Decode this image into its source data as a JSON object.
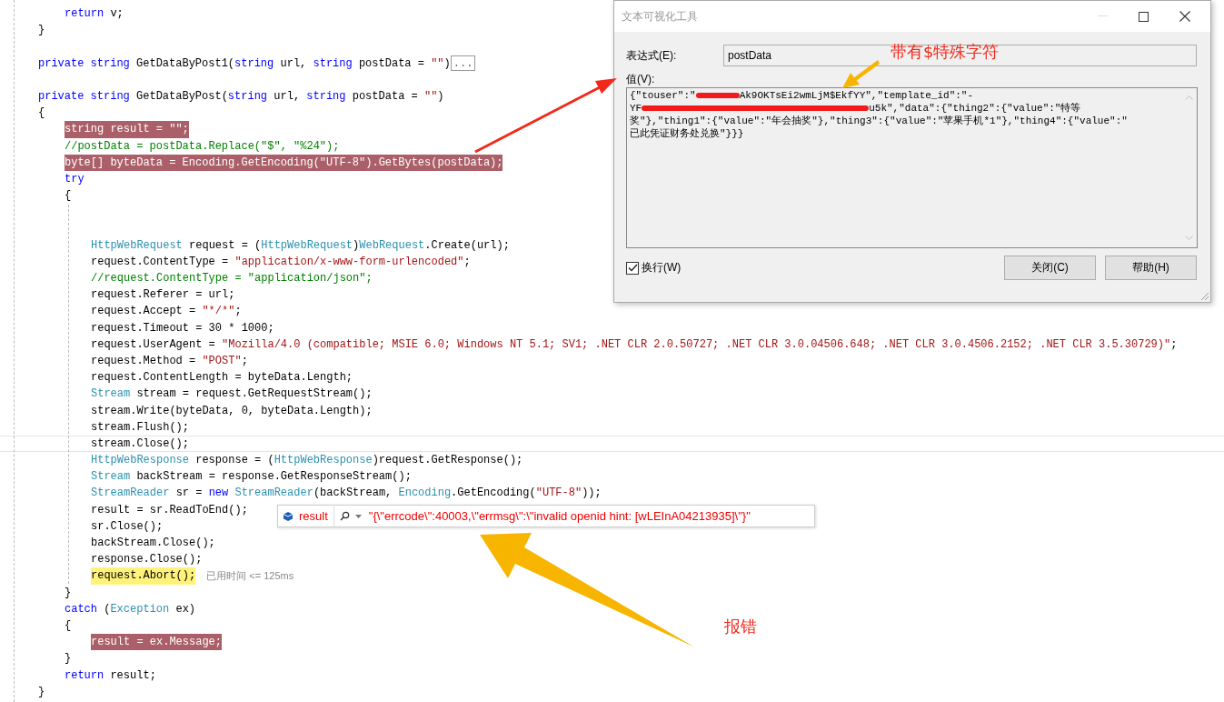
{
  "code": {
    "lines": [
      {
        "kind": "offscreen",
        "children": [
          {
            "kind": "code",
            "breakpoint": false,
            "current": false,
            "caret": false,
            "tokens": [
              {
                "kind": "kw",
                "text": "return "
              },
              {
                "kind": "plain",
                "text": "v;"
              }
            ]
          }
        ]
      },
      {
        "kind": "code",
        "breakpoint": false,
        "current": false,
        "caret": false,
        "tokens": [
          {
            "kind": "plain",
            "text": "}"
          }
        ]
      },
      {
        "kind": "blank"
      },
      {
        "kind": "code",
        "breakpoint": false,
        "current": false,
        "caret": false,
        "tokens": [
          {
            "kind": "kw",
            "text": "private "
          },
          {
            "kind": "kw",
            "text": "string "
          },
          {
            "kind": "plain",
            "text": "GetDataByPost1("
          },
          {
            "kind": "kw",
            "text": "string "
          },
          {
            "kind": "plain",
            "text": "url, "
          },
          {
            "kind": "kw",
            "text": "string "
          },
          {
            "kind": "plain",
            "text": "postData = "
          },
          {
            "kind": "str",
            "text": "\"\""
          },
          {
            "kind": "plain",
            "text": ")"
          }
        ],
        "collapsed": "..."
      },
      {
        "kind": "blank"
      },
      {
        "kind": "code",
        "breakpoint": false,
        "current": false,
        "caret": false,
        "tokens": [
          {
            "kind": "kw",
            "text": "private "
          },
          {
            "kind": "kw",
            "text": "string "
          },
          {
            "kind": "plain",
            "text": "GetDataByPost("
          },
          {
            "kind": "kw",
            "text": "string "
          },
          {
            "kind": "plain",
            "text": "url, "
          },
          {
            "kind": "kw",
            "text": "string "
          },
          {
            "kind": "plain",
            "text": "postData = "
          },
          {
            "kind": "str",
            "text": "\"\""
          },
          {
            "kind": "plain",
            "text": ")"
          }
        ]
      },
      {
        "kind": "code",
        "breakpoint": false,
        "current": false,
        "caret": false,
        "tokens": [
          {
            "kind": "plain",
            "text": "{"
          }
        ],
        "children": [
          {
            "kind": "code",
            "breakpoint": true,
            "current": false,
            "caret": false,
            "text": "string result = \"\";"
          },
          {
            "kind": "code",
            "breakpoint": false,
            "current": false,
            "caret": false,
            "tokens": [
              {
                "kind": "comment",
                "text": "//postData = postData.Replace(\"$\", \"%24\");"
              }
            ]
          },
          {
            "kind": "code",
            "breakpoint": true,
            "current": false,
            "caret": false,
            "text": "byte[] byteData = Encoding.GetEncoding(\"UTF-8\").GetBytes(postData);"
          },
          {
            "kind": "code",
            "breakpoint": false,
            "current": false,
            "caret": false,
            "tokens": [
              {
                "kind": "kw",
                "text": "try"
              }
            ]
          },
          {
            "kind": "code",
            "breakpoint": false,
            "current": false,
            "caret": false,
            "tokens": [
              {
                "kind": "plain",
                "text": "{"
              }
            ],
            "children": [
              {
                "kind": "blank"
              },
              {
                "kind": "blank"
              },
              {
                "kind": "code",
                "breakpoint": false,
                "current": false,
                "caret": false,
                "tokens": [
                  {
                    "kind": "type",
                    "text": "HttpWebRequest "
                  },
                  {
                    "kind": "plain",
                    "text": "request = ("
                  },
                  {
                    "kind": "type",
                    "text": "HttpWebRequest"
                  },
                  {
                    "kind": "plain",
                    "text": ")"
                  },
                  {
                    "kind": "type",
                    "text": "WebRequest"
                  },
                  {
                    "kind": "plain",
                    "text": ".Create(url);"
                  }
                ]
              },
              {
                "kind": "code",
                "breakpoint": false,
                "current": false,
                "caret": false,
                "tokens": [
                  {
                    "kind": "plain",
                    "text": "request.ContentType = "
                  },
                  {
                    "kind": "str",
                    "text": "\"application/x-www-form-urlencoded\""
                  },
                  {
                    "kind": "plain",
                    "text": ";"
                  }
                ]
              },
              {
                "kind": "code",
                "breakpoint": false,
                "current": false,
                "caret": false,
                "tokens": [
                  {
                    "kind": "comment",
                    "text": "//request.ContentType = \"application/json\";"
                  }
                ]
              },
              {
                "kind": "code",
                "breakpoint": false,
                "current": false,
                "caret": false,
                "tokens": [
                  {
                    "kind": "plain",
                    "text": "request.Referer = url;"
                  }
                ]
              },
              {
                "kind": "code",
                "breakpoint": false,
                "current": false,
                "caret": false,
                "tokens": [
                  {
                    "kind": "plain",
                    "text": "request.Accept = "
                  },
                  {
                    "kind": "str",
                    "text": "\"*/*\""
                  },
                  {
                    "kind": "plain",
                    "text": ";"
                  }
                ]
              },
              {
                "kind": "code",
                "breakpoint": false,
                "current": false,
                "caret": false,
                "tokens": [
                  {
                    "kind": "plain",
                    "text": "request.Timeout = 30 * 1000;"
                  }
                ]
              },
              {
                "kind": "code",
                "breakpoint": false,
                "current": false,
                "caret": false,
                "tokens": [
                  {
                    "kind": "plain",
                    "text": "request.UserAgent = "
                  },
                  {
                    "kind": "str",
                    "text": "\"Mozilla/4.0 (compatible; MSIE 6.0; Windows NT 5.1; SV1; .NET CLR 2.0.50727; .NET CLR 3.0.04506.648; .NET CLR 3.0.4506.2152; .NET CLR 3.5.30729)\""
                  },
                  {
                    "kind": "plain",
                    "text": ";"
                  }
                ]
              },
              {
                "kind": "code",
                "breakpoint": false,
                "current": false,
                "caret": false,
                "tokens": [
                  {
                    "kind": "plain",
                    "text": "request.Method = "
                  },
                  {
                    "kind": "str",
                    "text": "\"POST\""
                  },
                  {
                    "kind": "plain",
                    "text": ";"
                  }
                ]
              },
              {
                "kind": "code",
                "breakpoint": false,
                "current": false,
                "caret": false,
                "tokens": [
                  {
                    "kind": "plain",
                    "text": "request.ContentLength = byteData.Length;"
                  }
                ]
              },
              {
                "kind": "code",
                "breakpoint": false,
                "current": false,
                "caret": false,
                "tokens": [
                  {
                    "kind": "type",
                    "text": "Stream "
                  },
                  {
                    "kind": "plain",
                    "text": "stream = request.GetRequestStream();"
                  }
                ]
              },
              {
                "kind": "code",
                "breakpoint": false,
                "current": false,
                "caret": false,
                "tokens": [
                  {
                    "kind": "plain",
                    "text": "stream.Write(byteData, 0, byteData.Length);"
                  }
                ]
              },
              {
                "kind": "code",
                "breakpoint": false,
                "current": false,
                "caret": false,
                "tokens": [
                  {
                    "kind": "plain",
                    "text": "stream.Flush();"
                  }
                ]
              },
              {
                "kind": "code",
                "breakpoint": false,
                "current": false,
                "caret": true,
                "tokens": [
                  {
                    "kind": "plain",
                    "text": "stream.Close();"
                  }
                ]
              },
              {
                "kind": "code",
                "breakpoint": false,
                "current": false,
                "caret": false,
                "tokens": [
                  {
                    "kind": "type",
                    "text": "HttpWebResponse "
                  },
                  {
                    "kind": "plain",
                    "text": "response = ("
                  },
                  {
                    "kind": "type",
                    "text": "HttpWebResponse"
                  },
                  {
                    "kind": "plain",
                    "text": ")request.GetResponse();"
                  }
                ]
              },
              {
                "kind": "code",
                "breakpoint": false,
                "current": false,
                "caret": false,
                "tokens": [
                  {
                    "kind": "type",
                    "text": "Stream "
                  },
                  {
                    "kind": "plain",
                    "text": "backStream = response.GetResponseStream();"
                  }
                ]
              },
              {
                "kind": "code",
                "breakpoint": false,
                "current": false,
                "caret": false,
                "tokens": [
                  {
                    "kind": "type",
                    "text": "StreamReader "
                  },
                  {
                    "kind": "plain",
                    "text": "sr = "
                  },
                  {
                    "kind": "kw",
                    "text": "new "
                  },
                  {
                    "kind": "type",
                    "text": "StreamReader"
                  },
                  {
                    "kind": "plain",
                    "text": "(backStream, "
                  },
                  {
                    "kind": "type",
                    "text": "Encoding"
                  },
                  {
                    "kind": "plain",
                    "text": ".GetEncoding("
                  },
                  {
                    "kind": "str",
                    "text": "\"UTF-8\""
                  },
                  {
                    "kind": "plain",
                    "text": "));"
                  }
                ]
              },
              {
                "kind": "code",
                "breakpoint": false,
                "current": false,
                "caret": false,
                "tokens": [
                  {
                    "kind": "plain",
                    "text": "result = sr.ReadToEnd();"
                  }
                ]
              },
              {
                "kind": "code",
                "breakpoint": false,
                "current": false,
                "caret": false,
                "tokens": [
                  {
                    "kind": "plain",
                    "text": "sr.Close();"
                  }
                ]
              },
              {
                "kind": "code",
                "breakpoint": false,
                "current": false,
                "caret": false,
                "tokens": [
                  {
                    "kind": "plain",
                    "text": "backStream.Close();"
                  }
                ]
              },
              {
                "kind": "code",
                "breakpoint": false,
                "current": false,
                "caret": false,
                "tokens": [
                  {
                    "kind": "plain",
                    "text": "response.Close();"
                  }
                ]
              },
              {
                "kind": "code",
                "breakpoint": false,
                "current": true,
                "caret": false,
                "tokens": [
                  {
                    "kind": "plain",
                    "text": "request.Abort();"
                  }
                ],
                "hint": "已用时间 <= 125ms"
              }
            ]
          },
          {
            "kind": "code",
            "breakpoint": false,
            "current": false,
            "caret": false,
            "tokens": [
              {
                "kind": "plain",
                "text": "}"
              }
            ]
          },
          {
            "kind": "code",
            "breakpoint": false,
            "current": false,
            "caret": false,
            "tokens": [
              {
                "kind": "kw",
                "text": "catch "
              },
              {
                "kind": "plain",
                "text": "("
              },
              {
                "kind": "type",
                "text": "Exception "
              },
              {
                "kind": "plain",
                "text": "ex)"
              }
            ]
          },
          {
            "kind": "code",
            "breakpoint": false,
            "current": false,
            "caret": false,
            "tokens": [
              {
                "kind": "plain",
                "text": "{"
              }
            ],
            "children": [
              {
                "kind": "code",
                "breakpoint": true,
                "current": false,
                "caret": false,
                "text": "result = ex.Message;"
              }
            ]
          },
          {
            "kind": "code",
            "breakpoint": false,
            "current": false,
            "caret": false,
            "tokens": [
              {
                "kind": "plain",
                "text": "}"
              }
            ]
          },
          {
            "kind": "code",
            "breakpoint": false,
            "current": false,
            "caret": false,
            "tokens": [
              {
                "kind": "kw",
                "text": "return "
              },
              {
                "kind": "plain",
                "text": "result;"
              }
            ]
          }
        ]
      },
      {
        "kind": "code",
        "breakpoint": false,
        "current": false,
        "caret": false,
        "tokens": [
          {
            "kind": "plain",
            "text": "}"
          }
        ]
      }
    ]
  },
  "datatip": {
    "name": "result",
    "value": "\"{\\\"errcode\\\":40003,\\\"errmsg\\\":\\\"invalid openid hint: [wLEInA04213935]\\\"}\""
  },
  "dialog": {
    "title": "文本可视化工具",
    "expression_label": "表达式(E):",
    "expression_value": "postData",
    "value_label": "值(V):",
    "value_lines": [
      [
        {
          "kind": "text",
          "text": "{\"touser\":\""
        },
        {
          "kind": "redacted"
        },
        {
          "kind": "text",
          "text": "Ak9OKTsEi2wmLjM$EkfYY\",\"template_id\":\"-"
        }
      ],
      [
        {
          "kind": "text",
          "text": "YF"
        },
        {
          "kind": "redacted"
        },
        {
          "kind": "text",
          "text": "u5k\",\"data\":{\"thing2\":{\"value\":\"特等"
        }
      ],
      [
        {
          "kind": "text",
          "text": "奖\"},\"thing1\":{\"value\":\"年会抽奖\"},\"thing3\":{\"value\":\"苹果手机*1\"},\"thing4\":{\"value\":\""
        }
      ],
      [
        {
          "kind": "text",
          "text": "已此凭证财务处兑换\"}}}"
        }
      ]
    ],
    "wrap": {
      "label": "换行(W)",
      "checked": true
    },
    "buttons": [
      "关闭(C)",
      "帮助(H)"
    ]
  },
  "annotations": {
    "special_char_note": "带有$特殊字符",
    "error_note": "报错"
  }
}
